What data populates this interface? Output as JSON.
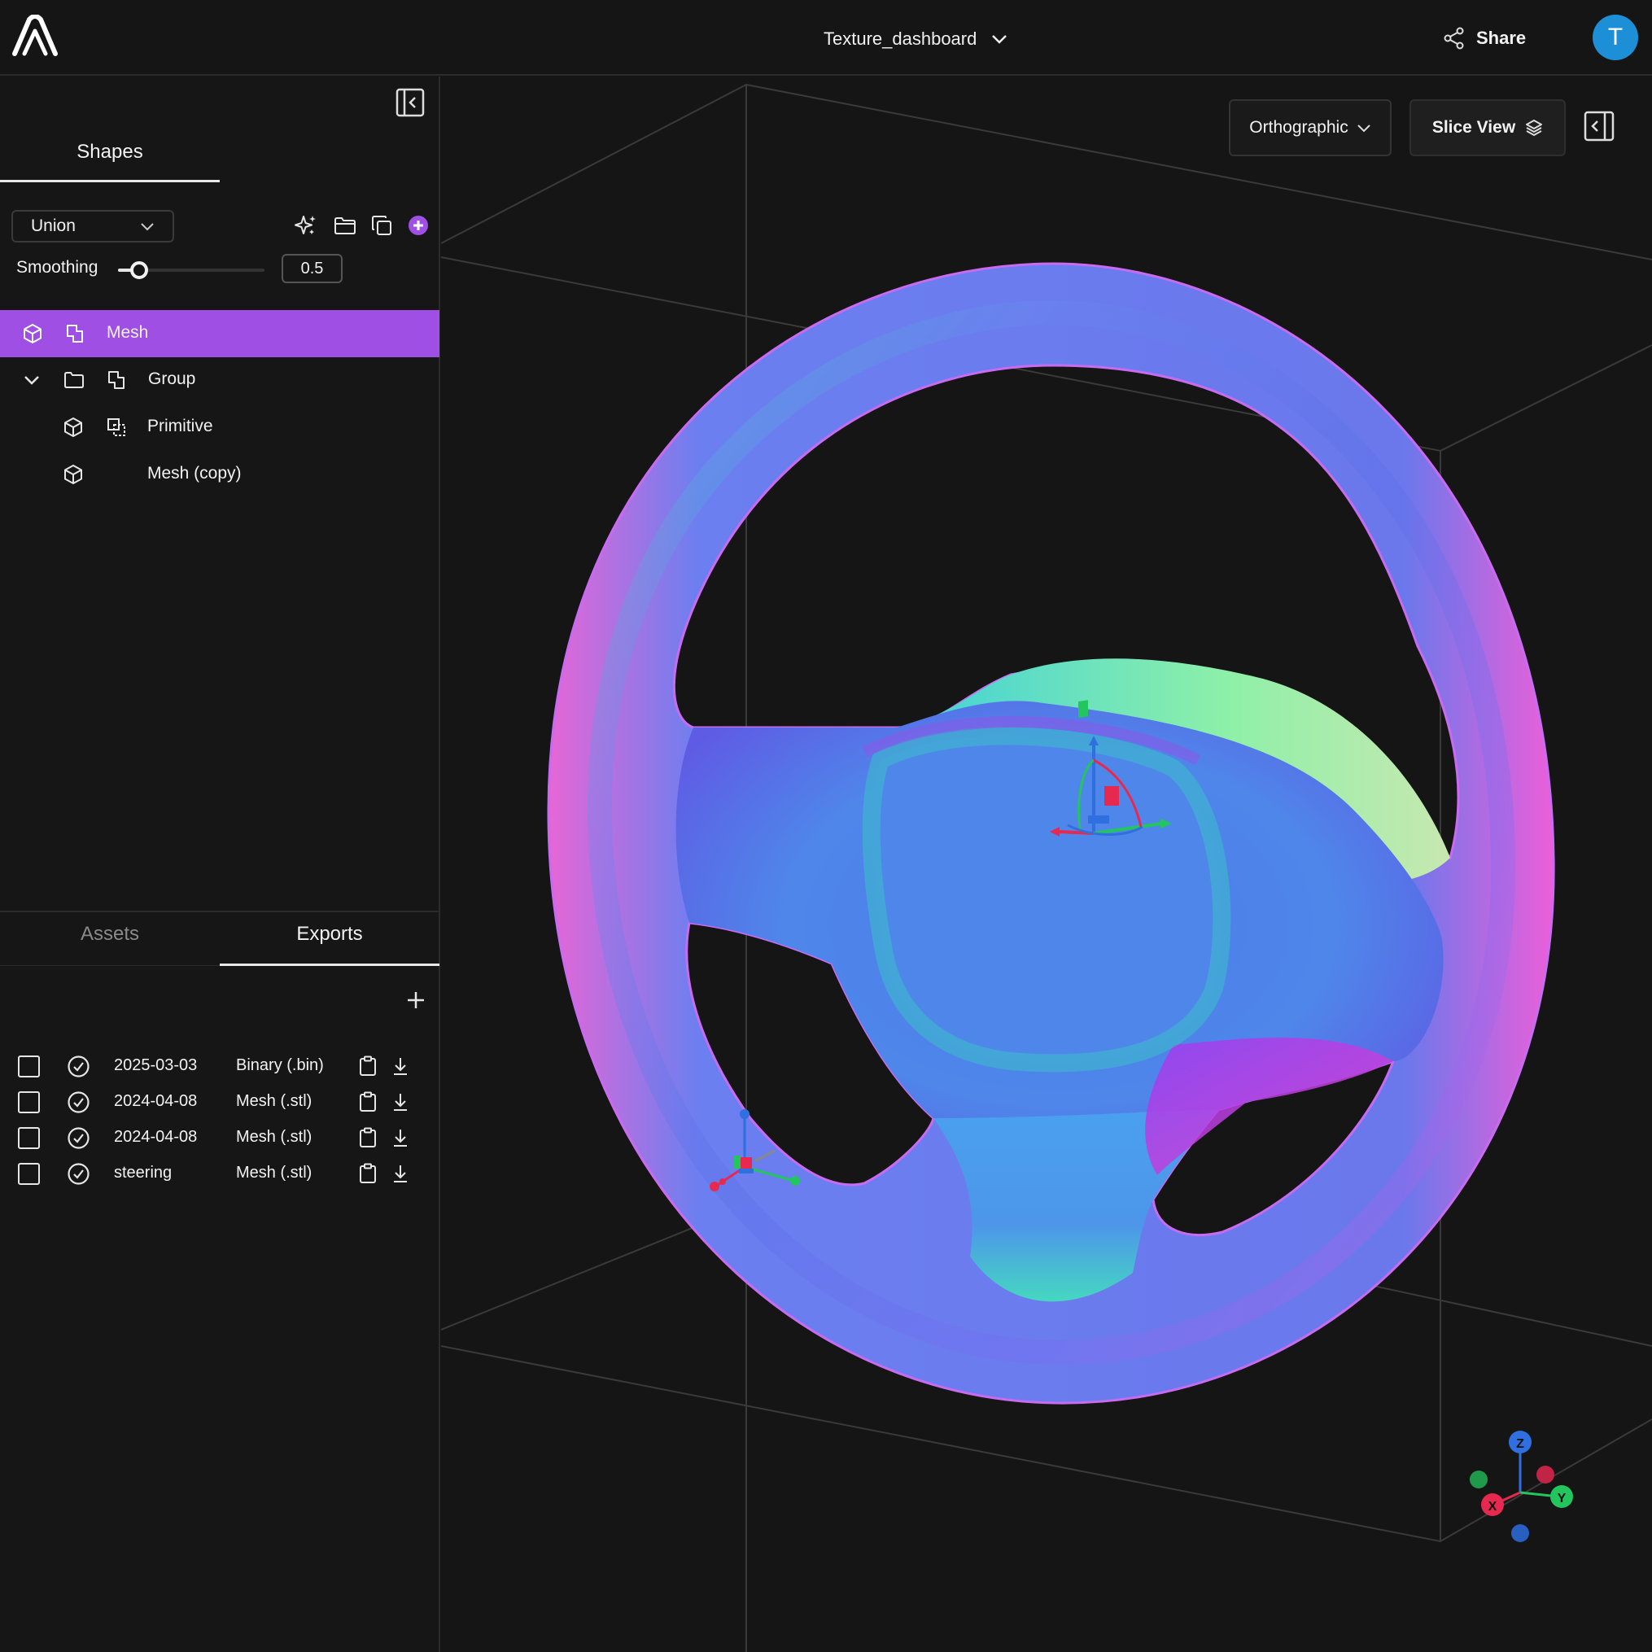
{
  "header": {
    "document_title": "Texture_dashboard",
    "share_label": "Share",
    "avatar_initial": "T"
  },
  "sidebar": {
    "shapes_tab": "Shapes",
    "operation": "Union",
    "smoothing_label": "Smoothing",
    "smoothing_value": "0.5",
    "smoothing_fraction": 0.1,
    "tree": [
      {
        "label": "Mesh",
        "type": "mesh",
        "selected": true
      },
      {
        "label": "Group",
        "type": "group",
        "expanded": true
      },
      {
        "label": "Primitive",
        "type": "primitive"
      },
      {
        "label": "Mesh (copy)",
        "type": "mesh"
      }
    ],
    "bottom_tabs": {
      "assets": "Assets",
      "exports": "Exports",
      "active": "Exports"
    },
    "exports": [
      {
        "name": "2025-03-03",
        "format": "Binary (.bin)"
      },
      {
        "name": "2024-04-08",
        "format": "Mesh (.stl)"
      },
      {
        "name": "2024-04-08",
        "format": "Mesh (.stl)"
      },
      {
        "name": "steering",
        "format": "Mesh (.stl)"
      }
    ]
  },
  "viewport": {
    "projection": "Orthographic",
    "slice_view_label": "Slice View",
    "axis_labels": {
      "x": "X",
      "y": "Y",
      "z": "Z"
    }
  },
  "colors": {
    "accent": "#a04fe4",
    "avatar": "#1d8fd6",
    "axis_x": "#e8294f",
    "axis_y": "#22c55e",
    "axis_z": "#2f6fe0"
  },
  "icons": {
    "logo": "app-logo-icon",
    "share": "share-icon",
    "collapse_sidebar": "collapse-sidebar-icon",
    "ai": "sparkles-icon",
    "folder": "folder-icon",
    "duplicate": "duplicate-icon",
    "add": "plus-circle-icon"
  }
}
